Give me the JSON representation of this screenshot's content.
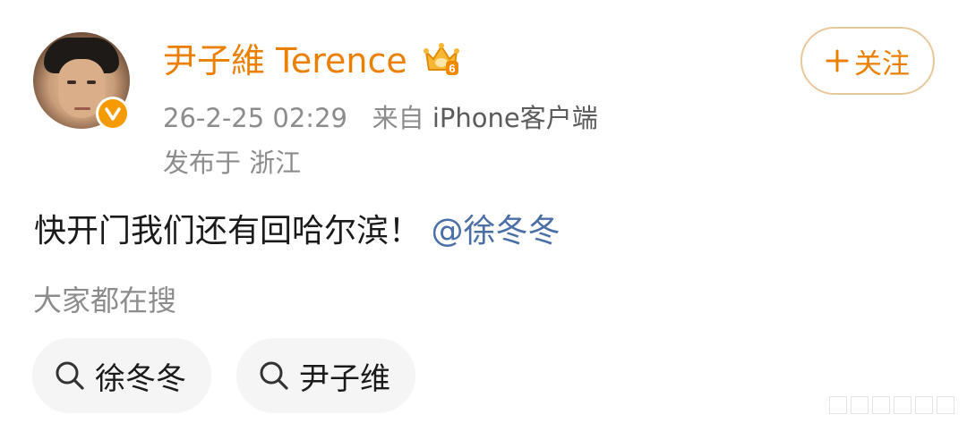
{
  "post": {
    "author": {
      "name": "尹子維 Terence",
      "avatar_icon": "avatar",
      "verified_icon": "verified-badge-icon",
      "vip_icon": "crown-vip-icon",
      "vip_level": "6"
    },
    "follow_label": "关注",
    "timestamp": "26-2-25 02:29",
    "source_prefix": "来自",
    "source": "iPhone客户端",
    "location": "发布于 浙江",
    "content_text": "快开门我们还有回哈尔滨！",
    "mention": "@徐冬冬"
  },
  "search": {
    "label": "大家都在搜",
    "chips": [
      {
        "label": "徐冬冬",
        "icon": "search-icon"
      },
      {
        "label": "尹子维",
        "icon": "search-icon"
      }
    ]
  },
  "colors": {
    "accent": "#ea7f00",
    "link": "#4a6ea6",
    "meta": "#8c8c8c",
    "chip_bg": "#f5f5f5"
  }
}
